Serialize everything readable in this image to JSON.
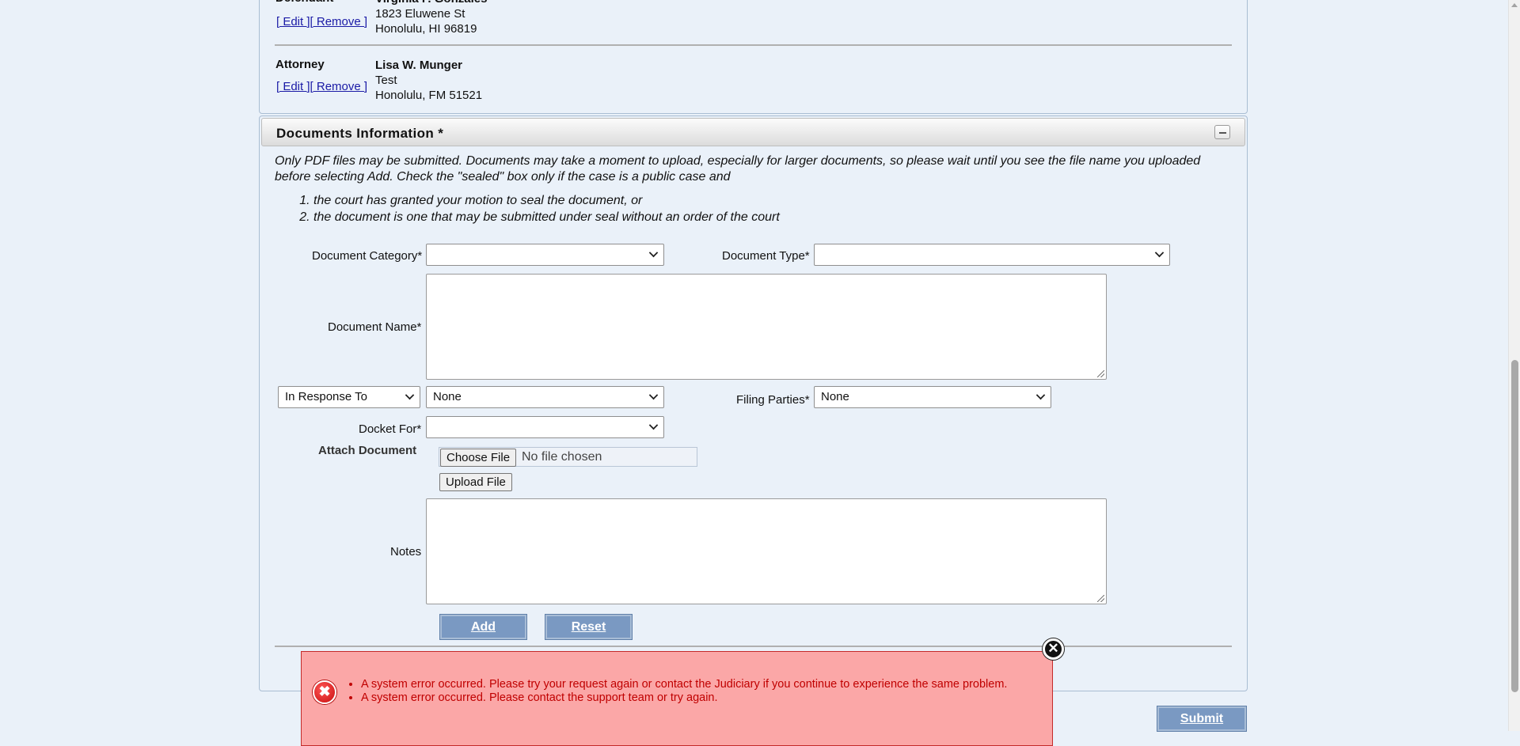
{
  "parties": [
    {
      "role": "Defendant",
      "name": "Virginia F. Gonzales",
      "edit_label": "[ Edit ]",
      "remove_label": "[ Remove ]",
      "address_line1": "1823 Eluwene St",
      "address_line2": "Honolulu, HI 96819"
    },
    {
      "role": "Attorney",
      "name": "Lisa W. Munger",
      "edit_label": "[ Edit ]",
      "remove_label": "[ Remove ]",
      "address_line1": "Test",
      "address_line2": "Honolulu, FM 51521"
    }
  ],
  "documents": {
    "title": "Documents Information *",
    "instructions": "Only PDF files may be submitted. Documents may take a moment to upload, especially for larger documents, so please wait until you see the file name you uploaded before selecting Add. Check the \"sealed\" box only if the case is a public case and",
    "conditions": [
      "the court has granted your motion to seal the document, or",
      "the document is one that may be submitted under seal without an order of the court"
    ],
    "fields": {
      "category_label": "Document Category*",
      "category_value": "",
      "type_label": "Document Type*",
      "type_value": "",
      "name_label": "Document Name*",
      "response_select": "In Response To",
      "response_value": "None",
      "filing_parties_label": "Filing Parties*",
      "filing_parties_value": "None",
      "docket_for_label": "Docket For*",
      "docket_for_value": "",
      "attach_label": "Attach Document",
      "choose_file_label": "Choose File",
      "no_file_text": "No file chosen",
      "upload_label": "Upload File",
      "notes_label": "Notes"
    },
    "add_label": "Add",
    "reset_label": "Reset"
  },
  "submit_label": "Submit",
  "errors": [
    "A system error occurred. Please try your request again or contact the Judiciary if you continue to experience the same problem.",
    "A system error occurred. Please contact the support team or try again."
  ],
  "colors": {
    "page_bg": "#eaf1f9",
    "button_blue": "#7a99c2",
    "error_bg": "#fba7a7",
    "error_text": "#c00000"
  }
}
